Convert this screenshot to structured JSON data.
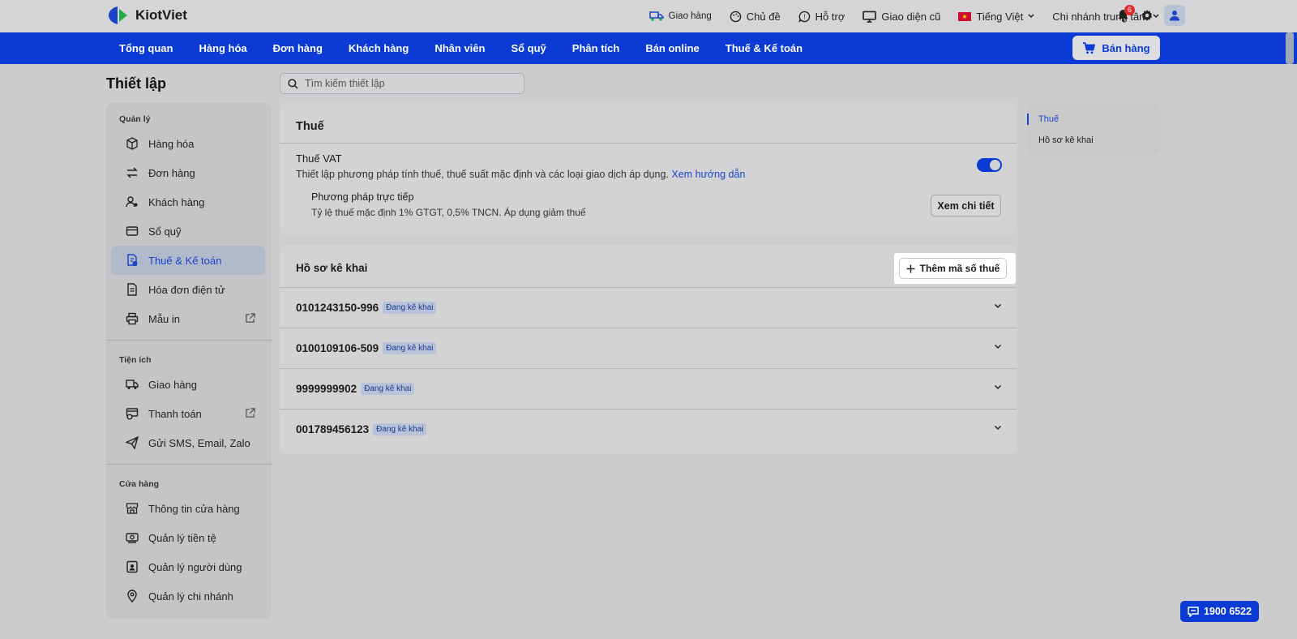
{
  "app": {
    "logo_text": "KiotViet"
  },
  "topbar": {
    "shipping": "Giao hàng",
    "theme": "Chủ đề",
    "support": "Hỗ trợ",
    "old_ui": "Giao diện cũ",
    "language": "Tiếng Việt",
    "branch": "Chi nhánh trung tâm",
    "notification_count": "6"
  },
  "nav": {
    "items": [
      "Tổng quan",
      "Hàng hóa",
      "Đơn hàng",
      "Khách hàng",
      "Nhân viên",
      "Sổ quỹ",
      "Phân tích",
      "Bán online",
      "Thuế & Kế toán"
    ],
    "sell_button": "Bán hàng"
  },
  "page": {
    "title": "Thiết lập",
    "search_placeholder": "Tìm kiếm thiết lập"
  },
  "sidebar": {
    "sections": [
      {
        "title": "Quản lý",
        "items": [
          "Hàng hóa",
          "Đơn hàng",
          "Khách hàng",
          "Sổ quỹ",
          "Thuế & Kế toán",
          "Hóa đơn điện tử",
          "Mẫu in"
        ]
      },
      {
        "title": "Tiện ích",
        "items": [
          "Giao hàng",
          "Thanh toán",
          "Gửi SMS, Email, Zalo"
        ]
      },
      {
        "title": "Cửa hàng",
        "items": [
          "Thông tin cửa hàng",
          "Quản lý tiền tệ",
          "Quản lý người dùng",
          "Quản lý chi nhánh"
        ]
      }
    ],
    "active": "Thuế & Kế toán"
  },
  "tax_card": {
    "title": "Thuế",
    "vat_title": "Thuế VAT",
    "vat_desc": "Thiết lập phương pháp tính thuế, thuế suất mặc định và các loại giao dịch áp dụng.",
    "vat_link": "Xem hướng dẫn",
    "vat_enabled": true,
    "method_title": "Phương pháp trực tiếp",
    "method_desc": "Tỷ lệ thuế mặc định 1% GTGT, 0,5% TNCN. Áp dụng giảm thuế",
    "detail_button": "Xem chi tiết"
  },
  "declaration_card": {
    "title": "Hồ sơ kê khai",
    "add_button": "Thêm mã số thuế",
    "rows": [
      {
        "code": "0101243150-996",
        "status": "Đang kê khai"
      },
      {
        "code": "0100109106-509",
        "status": "Đang kê khai"
      },
      {
        "code": "9999999902",
        "status": "Đang kê khai"
      },
      {
        "code": "001789456123",
        "status": "Đang kê khai"
      }
    ]
  },
  "right_nav": {
    "items": [
      "Thuế",
      "Hồ sơ kê khai"
    ]
  },
  "hotline": "1900 6522"
}
